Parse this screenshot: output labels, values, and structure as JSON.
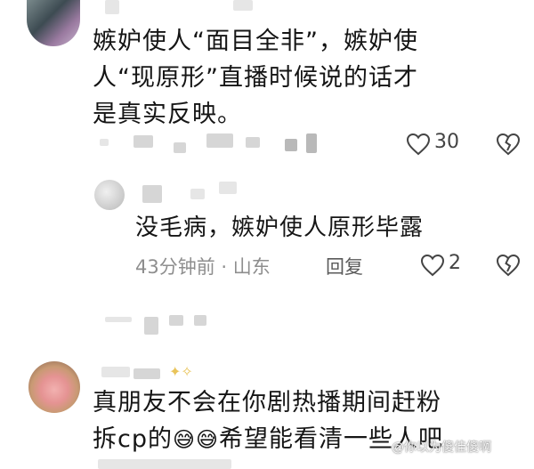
{
  "comments": [
    {
      "text": "嫉妒使人“面目全非”，嫉妒使人“现原形”直播时候说的话才是真实反映。",
      "lines": [
        "嫉妒使人“面目全非”，嫉妒使",
        "人“现原形”直播时候说的话才",
        "是真实反映。"
      ],
      "likes": "30"
    },
    {
      "text": "真朋友不会在你剧热播期间赶粉拆cp的😅😅希望能看清一些人吧",
      "line1": "真朋友不会在你剧热播期间赶粉",
      "line2_prefix": "拆cp的",
      "emoji": "😅😅",
      "line2_suffix": "希望能看清一些人吧"
    }
  ],
  "reply": {
    "text": "没毛病，嫉妒使人原形毕露",
    "time": "43分钟前",
    "location": "山东",
    "reply_label": "回复",
    "likes": "2"
  },
  "watermark": "@你以为傻佳傻啊",
  "icons": [
    "heart-icon",
    "broken-heart-icon"
  ],
  "colors": {
    "text": "#151515",
    "meta": "#8e8e8e",
    "icon": "#444444"
  }
}
